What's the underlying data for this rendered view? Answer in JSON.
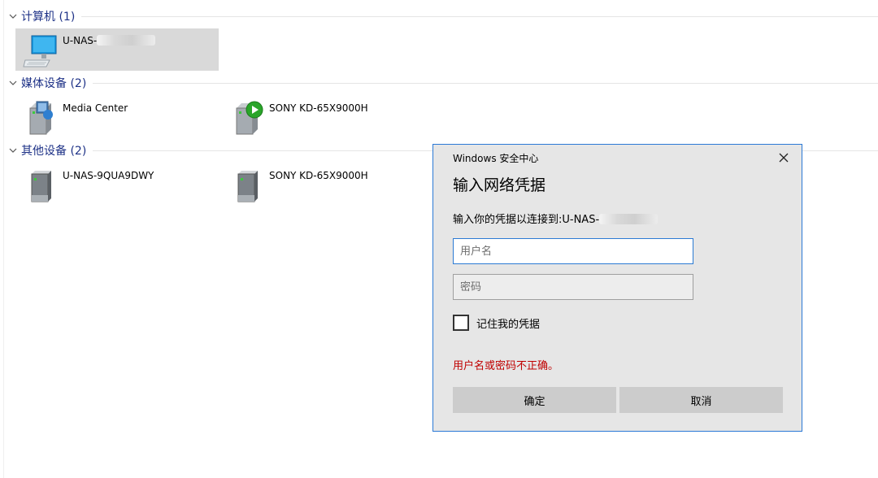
{
  "groups": [
    {
      "title": "计算机 (1)",
      "items": [
        {
          "label": "U-NAS-",
          "icon": "computer-monitor-icon",
          "redacted": true,
          "selected": true
        }
      ]
    },
    {
      "title": "媒体设备 (2)",
      "items": [
        {
          "label": "Media Center",
          "icon": "media-center-server-icon"
        },
        {
          "label": "SONY KD-65X9000H",
          "icon": "media-renderer-play-icon"
        }
      ]
    },
    {
      "title": "其他设备 (2)",
      "items": [
        {
          "label": "U-NAS-9QUA9DWY",
          "icon": "network-device-icon"
        },
        {
          "label": "SONY KD-65X9000H",
          "icon": "network-device-icon"
        }
      ]
    }
  ],
  "dialog": {
    "caption": "Windows 安全中心",
    "heading": "输入网络凭据",
    "prompt": "输入你的凭据以连接到:U-NAS-",
    "username_placeholder": "用户名",
    "username_value": "",
    "password_placeholder": "密码",
    "password_value": "",
    "remember_label": "记住我的凭据",
    "remember_checked": false,
    "error": "用户名或密码不正确。",
    "ok_label": "确定",
    "cancel_label": "取消"
  },
  "colors": {
    "group_title": "#1e3287",
    "dialog_border": "#2b79d6",
    "error": "#c00000",
    "selection": "#d9d9d9"
  }
}
